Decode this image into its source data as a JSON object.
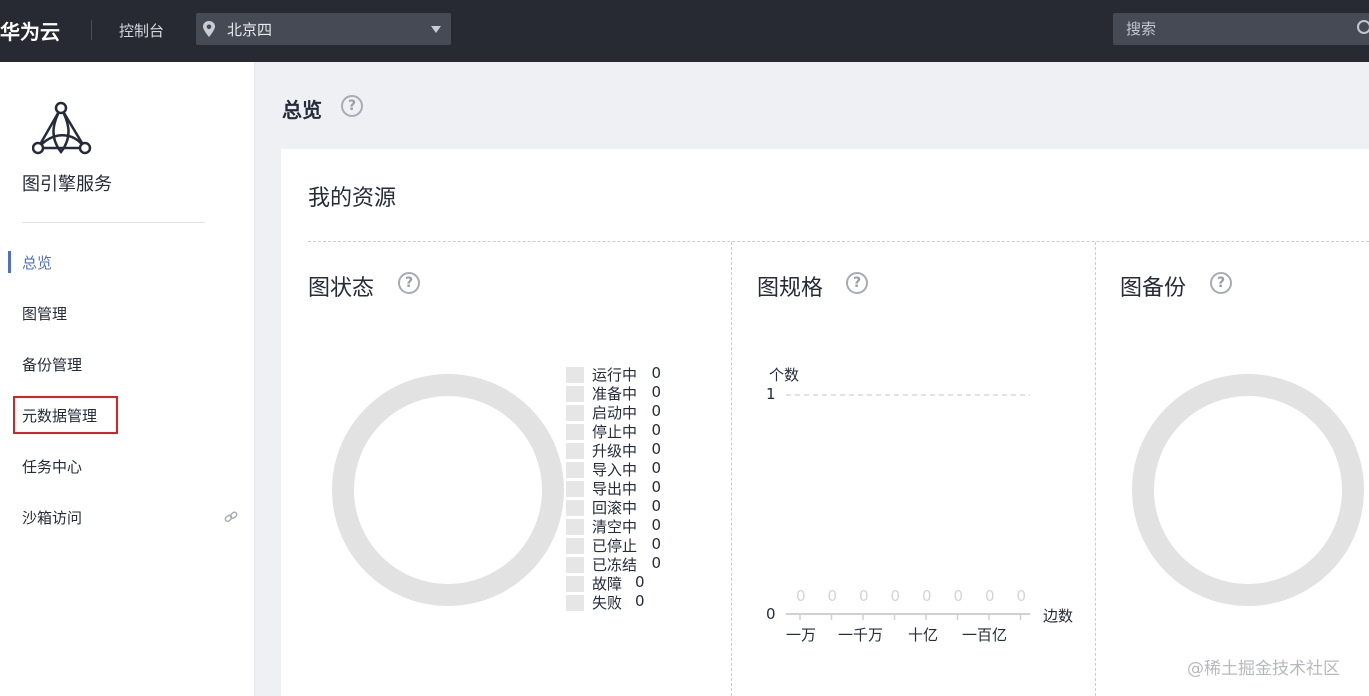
{
  "topbar": {
    "brand": "华为云",
    "console_label": "控制台",
    "region": "北京四",
    "search_placeholder": "搜索"
  },
  "sidebar": {
    "service_name": "图引擎服务",
    "items": [
      {
        "label": "总览",
        "active": true
      },
      {
        "label": "图管理"
      },
      {
        "label": "备份管理"
      },
      {
        "label": "元数据管理",
        "highlighted": true
      },
      {
        "label": "任务中心"
      },
      {
        "label": "沙箱访问",
        "icon": "link-icon"
      }
    ]
  },
  "main": {
    "page_title": "总览",
    "resources_title": "我的资源",
    "status": {
      "title": "图状态",
      "legend": [
        {
          "label": "运行中",
          "value": "0"
        },
        {
          "label": "准备中",
          "value": "0"
        },
        {
          "label": "启动中",
          "value": "0"
        },
        {
          "label": "停止中",
          "value": "0"
        },
        {
          "label": "升级中",
          "value": "0"
        },
        {
          "label": "导入中",
          "value": "0"
        },
        {
          "label": "导出中",
          "value": "0"
        },
        {
          "label": "回滚中",
          "value": "0"
        },
        {
          "label": "清空中",
          "value": "0"
        },
        {
          "label": "已停止",
          "value": "0"
        },
        {
          "label": "已冻结",
          "value": "0"
        },
        {
          "label": "故障",
          "value": "0"
        },
        {
          "label": "失败",
          "value": "0"
        }
      ]
    },
    "spec": {
      "title": "图规格",
      "ylabel": "个数",
      "xlabel": "边数",
      "y_ticks": [
        "1",
        "0"
      ],
      "x_ticks": [
        "一万",
        "一千万",
        "十亿",
        "一百亿"
      ],
      "bar_labels": [
        "0",
        "0",
        "0",
        "0",
        "0",
        "0",
        "0",
        "0"
      ]
    },
    "backup": {
      "title": "图备份"
    }
  },
  "watermark": "@稀土掘金技术社区",
  "chart_data": [
    {
      "type": "pie",
      "title": "图状态",
      "categories": [
        "运行中",
        "准备中",
        "启动中",
        "停止中",
        "升级中",
        "导入中",
        "导出中",
        "回滚中",
        "清空中",
        "已停止",
        "已冻结",
        "故障",
        "失败"
      ],
      "values": [
        0,
        0,
        0,
        0,
        0,
        0,
        0,
        0,
        0,
        0,
        0,
        0,
        0
      ],
      "legend": "right"
    },
    {
      "type": "bar",
      "title": "图规格",
      "ylabel": "个数",
      "xlabel": "边数",
      "x_ticks": [
        "一万",
        "一千万",
        "十亿",
        "一百亿"
      ],
      "values": [
        0,
        0,
        0,
        0,
        0,
        0,
        0,
        0
      ],
      "ylim": [
        0,
        1
      ]
    }
  ],
  "colors": {
    "topbar": "#272a32",
    "accent": "#526ecc",
    "highlight": "#e02020",
    "empty_ring": "#e2e2e2"
  }
}
